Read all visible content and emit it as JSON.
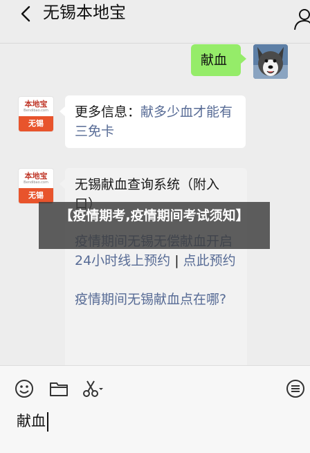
{
  "header": {
    "title": "无锡本地宝"
  },
  "messages": {
    "user_message": "献血",
    "bot_avatar": {
      "logo_text": "本地宝",
      "logo_url": "Bendibao.com",
      "city": "无锡"
    },
    "msg1": {
      "prefix": "更多信息：",
      "link": "献多少血才能有三免卡"
    },
    "msg2": {
      "line1": "无锡献血查询系统（附入口）",
      "link1": "疫情期间无锡无偿献血开启24小时线上预约",
      "separator": " | ",
      "link2": "点此预约",
      "link3": "疫情期间无锡献血点在哪?"
    }
  },
  "overlay": {
    "banner_text": "【疫情期考,疫情期间考试须知】"
  },
  "input_bar": {
    "typed_text": "献血"
  }
}
